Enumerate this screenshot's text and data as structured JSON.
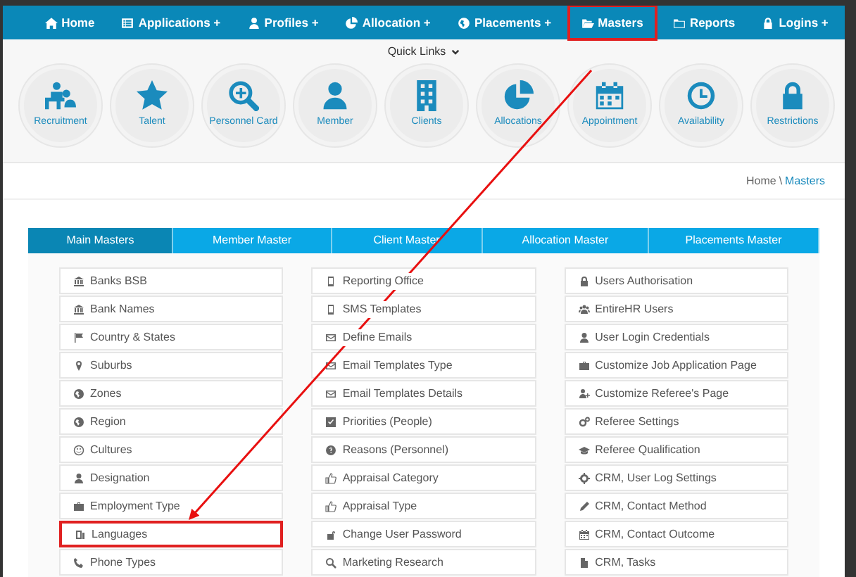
{
  "nav": [
    {
      "label": "Home",
      "highlighted": false
    },
    {
      "label": "Applications +",
      "highlighted": false
    },
    {
      "label": "Profiles +",
      "highlighted": false
    },
    {
      "label": "Allocation +",
      "highlighted": false
    },
    {
      "label": "Placements +",
      "highlighted": false
    },
    {
      "label": "Masters",
      "highlighted": true
    },
    {
      "label": "Reports",
      "highlighted": false
    },
    {
      "label": "Logins +",
      "highlighted": false
    }
  ],
  "quick_links": {
    "title": "Quick Links",
    "items": [
      "Recruitment",
      "Talent",
      "Personnel Card",
      "Member",
      "Clients",
      "Allocations",
      "Appointment",
      "Availability",
      "Restrictions"
    ]
  },
  "breadcrumb": [
    "Home",
    "\\",
    "Masters"
  ],
  "tabs": [
    {
      "label": "Main Masters",
      "selected": true
    },
    {
      "label": "Member Master",
      "selected": false
    },
    {
      "label": "Client Master",
      "selected": false
    },
    {
      "label": "Allocation Master",
      "selected": false
    },
    {
      "label": "Placements Master",
      "selected": false
    }
  ],
  "columns": [
    [
      {
        "label": "Banks BSB",
        "highlighted": false
      },
      {
        "label": "Bank Names",
        "highlighted": false
      },
      {
        "label": "Country & States",
        "highlighted": false
      },
      {
        "label": "Suburbs",
        "highlighted": false
      },
      {
        "label": "Zones",
        "highlighted": false
      },
      {
        "label": "Region",
        "highlighted": false
      },
      {
        "label": "Cultures",
        "highlighted": false
      },
      {
        "label": "Designation",
        "highlighted": false
      },
      {
        "label": "Employment Type",
        "highlighted": false
      },
      {
        "label": "Languages",
        "highlighted": true
      },
      {
        "label": "Phone Types",
        "highlighted": false
      }
    ],
    [
      {
        "label": "Reporting Office",
        "highlighted": false
      },
      {
        "label": "SMS Templates",
        "highlighted": false
      },
      {
        "label": "Define Emails",
        "highlighted": false
      },
      {
        "label": "Email Templates Type",
        "highlighted": false
      },
      {
        "label": "Email Templates Details",
        "highlighted": false
      },
      {
        "label": "Priorities (People)",
        "highlighted": false
      },
      {
        "label": "Reasons (Personnel)",
        "highlighted": false
      },
      {
        "label": "Appraisal Category",
        "highlighted": false
      },
      {
        "label": "Appraisal Type",
        "highlighted": false
      },
      {
        "label": "Change User Password",
        "highlighted": false
      },
      {
        "label": "Marketing Research",
        "highlighted": false
      }
    ],
    [
      {
        "label": "Users Authorisation",
        "highlighted": false
      },
      {
        "label": "EntireHR Users",
        "highlighted": false
      },
      {
        "label": "User Login Credentials",
        "highlighted": false
      },
      {
        "label": "Customize Job Application Page",
        "highlighted": false
      },
      {
        "label": "Customize Referee's Page",
        "highlighted": false
      },
      {
        "label": "Referee Settings",
        "highlighted": false
      },
      {
        "label": "Referee Qualification",
        "highlighted": false
      },
      {
        "label": "CRM, User Log Settings",
        "highlighted": false
      },
      {
        "label": "CRM, Contact Method",
        "highlighted": false
      },
      {
        "label": "CRM, Contact Outcome",
        "highlighted": false
      },
      {
        "label": "CRM, Tasks",
        "highlighted": false
      }
    ]
  ]
}
